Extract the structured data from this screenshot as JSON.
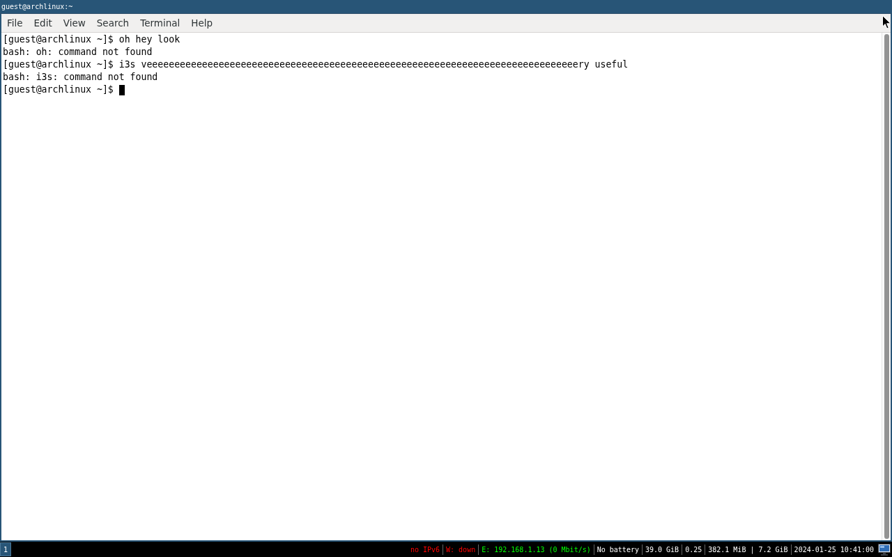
{
  "window": {
    "title": "guest@archlinux:~"
  },
  "menu_bar": [
    "File",
    "Edit",
    "View",
    "Search",
    "Terminal",
    "Help"
  ],
  "terminal": {
    "lines": [
      {
        "text": "[guest@archlinux ~]$ oh hey look",
        "cursor": false
      },
      {
        "text": "bash: oh: command not found",
        "cursor": false
      },
      {
        "text": "[guest@archlinux ~]$ i3s veeeeeeeeeeeeeeeeeeeeeeeeeeeeeeeeeeeeeeeeeeeeeeeeeeeeeeeeeeeeeeeeeeeeeeeeeeeeeery useful",
        "cursor": false
      },
      {
        "text": "bash: i3s: command not found",
        "cursor": false
      },
      {
        "text": "[guest@archlinux ~]$",
        "cursor": true
      }
    ]
  },
  "status_bar": {
    "workspaces": [
      {
        "label": "1",
        "selected": true
      }
    ],
    "items": [
      {
        "text": "no IPv6",
        "color": "#ff0000"
      },
      {
        "text": "W: down",
        "color": "#ff0000"
      },
      {
        "text": "E: 192.168.1.13 (0 Mbit/s)",
        "color": "#00ff00"
      },
      {
        "text": "No battery",
        "color": "#ffffff"
      },
      {
        "text": "39.0 GiB",
        "color": "#ffffff"
      },
      {
        "text": "0.25",
        "color": "#ffffff"
      },
      {
        "text": "382.1 MiB | 7.2 GiB",
        "color": "#ffffff"
      },
      {
        "text": "2024-01-25 10:41:00",
        "color": "#ffffff"
      }
    ]
  }
}
